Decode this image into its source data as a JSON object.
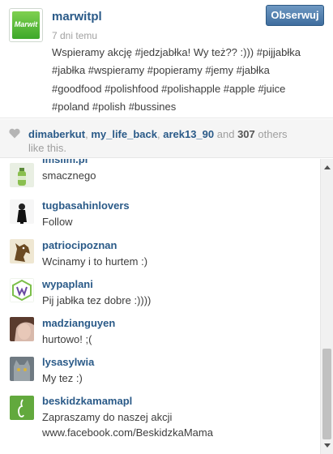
{
  "post": {
    "avatar_word": "Marwit",
    "username": "marwitpl",
    "time": "7 dni temu",
    "follow_label": "Obserwuj",
    "caption_lines": [
      "Wspieramy akcję #jedzjabłka! Wy też?? :))) #pijjabłka",
      "#jabłka #wspieramy #popieramy #jemy #jabłka",
      "#goodfood #polishfood #polishapple #apple #juice",
      "#poland #polish #bussines"
    ]
  },
  "likes": {
    "users": [
      "dimaberkut",
      "my_life_back",
      "arek13_90"
    ],
    "and": "and",
    "count": "307",
    "suffix_1": "others",
    "suffix_2": "like this."
  },
  "comments": [
    {
      "user": "imslim.pl",
      "text": [
        "smacznego"
      ],
      "avatar": "bottle-avatar"
    },
    {
      "user": "tugbasahinlovers",
      "text": [
        "Follow"
      ],
      "avatar": "person-avatar"
    },
    {
      "user": "patriocipoznan",
      "text": [
        "Wcinamy i to hurtem :)"
      ],
      "avatar": "horse-avatar"
    },
    {
      "user": "wypaplani",
      "text": [
        "Pij jabłka tez dobre :))))"
      ],
      "avatar": "logo-avatar"
    },
    {
      "user": "madzianguyen",
      "text": [
        "hurtowo! ;("
      ],
      "avatar": "face-avatar"
    },
    {
      "user": "lysasylwia",
      "text": [
        "My tez :)"
      ],
      "avatar": "cat-avatar"
    },
    {
      "user": "beskidzkamamapl",
      "text": [
        "Zapraszamy do naszej akcji",
        "www.facebook.com/BeskidzkaMama"
      ],
      "avatar": "apple-avatar"
    }
  ],
  "colors": {
    "username": "#2a5a88",
    "follow_button": "#4a78a8",
    "text": "#3d3d3d",
    "muted": "#a1a1a1"
  }
}
